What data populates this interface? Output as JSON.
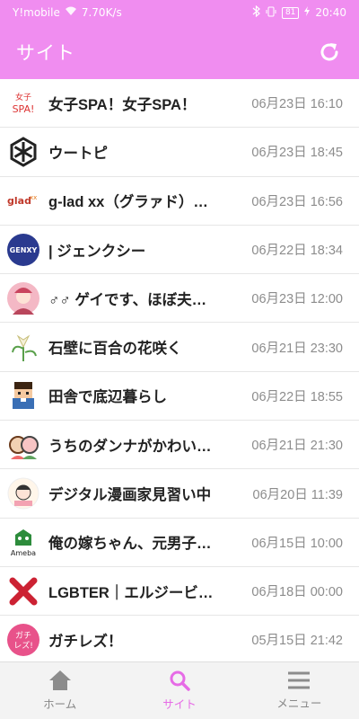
{
  "status": {
    "carrier": "Y!mobile",
    "speed": "7.70K/s",
    "battery": "81",
    "time": "20:40"
  },
  "appbar": {
    "title": "サイト"
  },
  "sites": [
    {
      "name": "女子SPA！女子SPA！",
      "date": "06月23日 16:10",
      "thumb_text": "女子\nSPA!"
    },
    {
      "name": "ウートピ",
      "date": "06月23日 18:45"
    },
    {
      "name": "g-lad xx（グラァド）…",
      "date": "06月23日 16:56",
      "thumb_text": "glad xx"
    },
    {
      "name": "| ジェンクシー",
      "date": "06月22日 18:34",
      "thumb_text": "GENXY"
    },
    {
      "name": "♂♂ ゲイです、ほぼ夫…",
      "date": "06月23日 12:00"
    },
    {
      "name": "石壁に百合の花咲く",
      "date": "06月21日 23:30"
    },
    {
      "name": "田舎で底辺暮らし",
      "date": "06月22日 18:55"
    },
    {
      "name": "うちのダンナがかわい…",
      "date": "06月21日 21:30"
    },
    {
      "name": "デジタル漫画家見習い中",
      "date": "06月20日 11:39"
    },
    {
      "name": "俺の嫁ちゃん、元男子…",
      "date": "06月15日 10:00",
      "thumb_text": "Ameba"
    },
    {
      "name": "LGBTER｜エルジービ…",
      "date": "06月18日 00:00"
    },
    {
      "name": "ガチレズ！",
      "date": "05月15日 21:42",
      "thumb_text": "ガチ\nレズ!"
    }
  ],
  "nav": {
    "home": "ホーム",
    "site": "サイト",
    "menu": "メニュー"
  },
  "colors": {
    "accent": "#f08df0",
    "active_nav": "#e66be6"
  }
}
